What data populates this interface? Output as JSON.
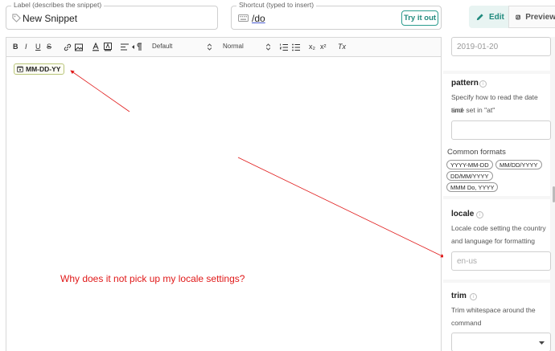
{
  "label_field": {
    "label": "Label (describes the snippet)",
    "value": "New Snippet"
  },
  "shortcut_field": {
    "label": "Shortcut (typed to insert)",
    "value": "/do",
    "try_label": "Try it out"
  },
  "view_tabs": {
    "edit": "Edit",
    "preview": "Preview"
  },
  "toolbar": {
    "bold": "B",
    "italic": "I",
    "underline": "U",
    "strike": "S",
    "font": "Default",
    "size": "Normal",
    "subscript": "x₂",
    "superscript": "x²",
    "clear": "Tx"
  },
  "editor": {
    "chip_label": "MM-DD-YY",
    "annotation": "Why does it not pick up my locale settings?"
  },
  "right_panel": {
    "at_value": "2019-01-20",
    "pattern": {
      "title": "pattern",
      "desc_line1": "Specify how to read the date and",
      "desc_line2": "time set in \"at\"",
      "formats_label": "Common formats",
      "formats": [
        "YYYY-MM-DD",
        "MM/DD/YYYY",
        "DD/MM/YYYY",
        "MMM Do, YYYY"
      ]
    },
    "locale": {
      "title": "locale",
      "desc_line1": "Locale code setting the country",
      "desc_line2": "and language for formatting",
      "placeholder": "en-us"
    },
    "trim": {
      "title": "trim",
      "desc_line1": "Trim whitespace around the",
      "desc_line2": "command"
    }
  },
  "colors": {
    "accent": "#1f8a7d",
    "annotation": "#e01919"
  }
}
